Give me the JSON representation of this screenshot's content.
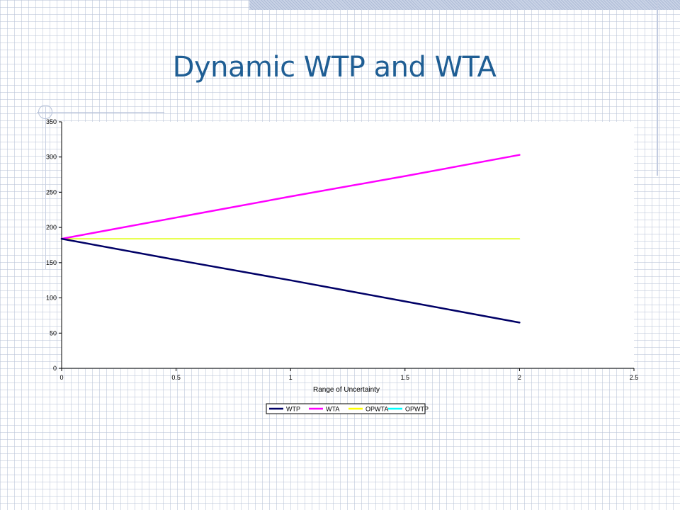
{
  "slide": {
    "title": "Dynamic WTP and WTA"
  },
  "chart_data": {
    "type": "line",
    "title": "",
    "xlabel": "Range of Uncertainty",
    "ylabel": "",
    "xlim": [
      0,
      2.5
    ],
    "ylim": [
      0,
      350
    ],
    "xticks": [
      0,
      0.5,
      1,
      1.5,
      2,
      2.5
    ],
    "xtick_labels": [
      "0",
      "0.5",
      "1",
      "1.5",
      "2",
      "2.5"
    ],
    "yticks": [
      0,
      50,
      100,
      150,
      200,
      250,
      300,
      350
    ],
    "ytick_labels": [
      "0",
      "50",
      "100",
      "150",
      "200",
      "250",
      "300",
      "350"
    ],
    "grid": false,
    "legend_position": "bottom",
    "x": [
      0,
      0.5,
      1,
      1.5,
      2
    ],
    "series": [
      {
        "name": "WTP",
        "color": "#000066",
        "values": [
          184,
          154,
          125,
          95,
          65
        ]
      },
      {
        "name": "WTA",
        "color": "#ff00ff",
        "values": [
          184,
          214,
          244,
          273,
          303
        ]
      },
      {
        "name": "OPWTA",
        "color": "#ffff00",
        "values": [
          184,
          184,
          184,
          184,
          184
        ]
      },
      {
        "name": "OPWTP",
        "color": "#00ffff",
        "values": [
          184,
          184,
          184,
          184,
          184
        ]
      }
    ]
  }
}
